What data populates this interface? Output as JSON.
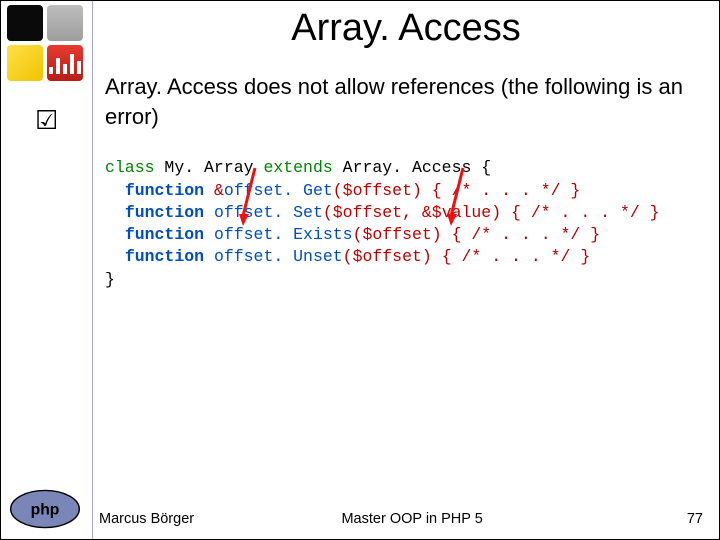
{
  "title": "Array. Access",
  "bullet": "Array. Access does not allow references (the following is an error)",
  "code": {
    "class_kw": "class ",
    "class_name": "My. Array ",
    "extends_kw": "extends",
    "base_name": " Array. Access ",
    "obr": "{",
    "indent": "  ",
    "function_kw": "function ",
    "amp": "&",
    "offsetGet": "offset. Get",
    "offsetSet": "offset. Set",
    "offsetExists": "offset. Exists",
    "offsetUnset": "offset. Unset",
    "open_paren": "(",
    "close_paren": ")",
    "offset_var": "$offset",
    "value_var": "$value",
    "comma_sp": ", ",
    "block_tail": " { /* . . . */ }",
    "close_brace": "}"
  },
  "footer": {
    "author": "Marcus Börger",
    "course": "Master OOP in PHP 5",
    "page": "77"
  },
  "icons": {
    "checkmark": "☑"
  }
}
